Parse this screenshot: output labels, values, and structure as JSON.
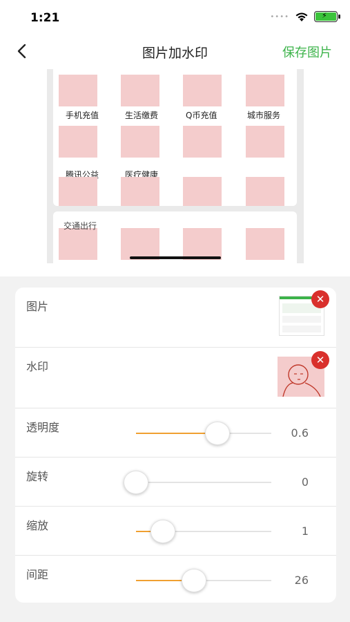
{
  "status_bar": {
    "time": "1:21"
  },
  "nav": {
    "title": "图片加水印",
    "save_label": "保存图片"
  },
  "preview": {
    "grid_row1": [
      "手机充值",
      "生活缴费",
      "Q币充值",
      "城市服务"
    ],
    "grid_row2": [
      "腾讯公益",
      "医疗健康"
    ],
    "section_title": "交通出行"
  },
  "settings": {
    "image_label": "图片",
    "watermark_label": "水印",
    "sliders": [
      {
        "label": "透明度",
        "value": "0.6",
        "fraction": 0.6
      },
      {
        "label": "旋转",
        "value": "0",
        "fraction": 0.0
      },
      {
        "label": "缩放",
        "value": "1",
        "fraction": 0.2
      },
      {
        "label": "间距",
        "value": "26",
        "fraction": 0.43
      }
    ]
  },
  "colors": {
    "accent_green": "#3cb34a",
    "slider_orange": "#f0a030",
    "delete_red": "#d9302c",
    "watermark_pink": "#f4cccc"
  }
}
